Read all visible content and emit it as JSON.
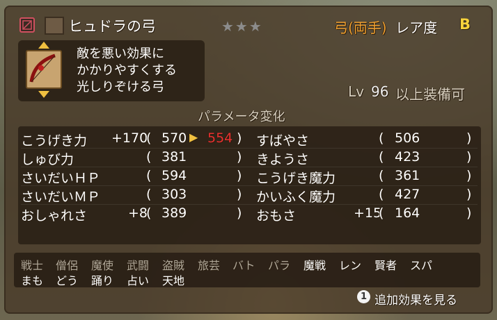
{
  "item": {
    "name": "ヒュドラの弓",
    "type": "弓(両手)",
    "rarity_label": "レア度",
    "rarity": "B",
    "stars": "★★★",
    "description": [
      "敵を悪い効果に",
      "かかりやすくする",
      "光しりぞける弓"
    ],
    "level_prefix": "Lv",
    "level": "96",
    "level_suffix": "以上装備可"
  },
  "params": {
    "title": "パラメータ変化",
    "left": [
      {
        "name": "こうげき力",
        "diff": "+170",
        "current": "570",
        "arrow": "▶",
        "new": "554"
      },
      {
        "name": "しゅび力",
        "diff": "",
        "current": "381"
      },
      {
        "name": "さいだいＨＰ",
        "diff": "",
        "current": "594"
      },
      {
        "name": "さいだいＭＰ",
        "diff": "",
        "current": "303"
      },
      {
        "name": "おしゃれさ",
        "diff": "+8",
        "current": "389"
      }
    ],
    "right": [
      {
        "name": "すばやさ",
        "diff": "",
        "current": "506"
      },
      {
        "name": "きようさ",
        "diff": "",
        "current": "423"
      },
      {
        "name": "こうげき魔力",
        "diff": "",
        "current": "361"
      },
      {
        "name": "かいふく魔力",
        "diff": "",
        "current": "427"
      },
      {
        "name": "おもさ",
        "diff": "+15",
        "current": "164"
      }
    ],
    "open": "(",
    "close": ")"
  },
  "jobs": {
    "row1": [
      {
        "label": "戦士",
        "active": false
      },
      {
        "label": "僧侶",
        "active": false
      },
      {
        "label": "魔使",
        "active": false
      },
      {
        "label": "武闘",
        "active": false
      },
      {
        "label": "盗賊",
        "active": false
      },
      {
        "label": "旅芸",
        "active": false
      },
      {
        "label": "バト",
        "active": false
      },
      {
        "label": "パラ",
        "active": false
      },
      {
        "label": "魔戦",
        "active": true
      },
      {
        "label": "レン",
        "active": true
      },
      {
        "label": "賢者",
        "active": true
      },
      {
        "label": "スパ",
        "active": true
      }
    ],
    "row2": [
      {
        "label": "まも",
        "active": true
      },
      {
        "label": "どう",
        "active": true
      },
      {
        "label": "踊り",
        "active": true
      },
      {
        "label": "占い",
        "active": true
      },
      {
        "label": "天地",
        "active": true
      }
    ]
  },
  "footer": {
    "button_num": "1",
    "label": "追加効果を見る"
  },
  "colors": {
    "accent_orange": "#f0a030",
    "rarity_yellow": "#f6d23c",
    "new_value_red": "#e83030",
    "arrow_yellow": "#f0c040",
    "job_inactive": "#b0a89a"
  }
}
